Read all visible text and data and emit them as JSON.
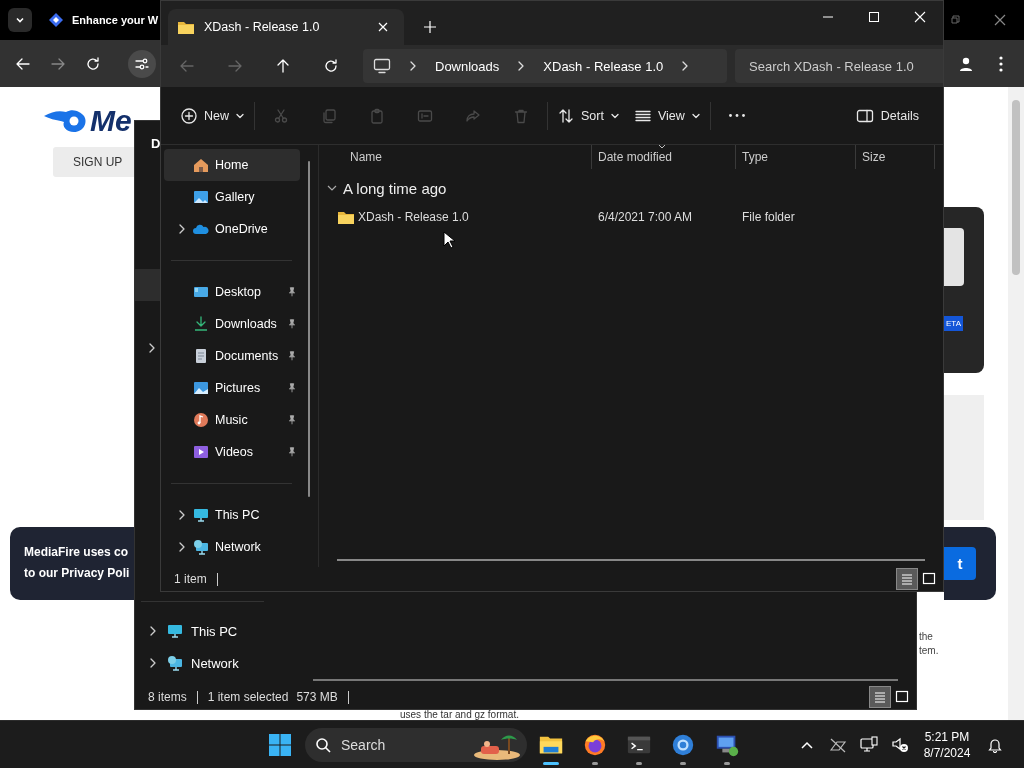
{
  "browser": {
    "tab": {
      "title": "Enhance your W"
    },
    "page": {
      "logo_text": "Me",
      "signup_button": "SIGN UP",
      "cookie_text": [
        "MediaFire uses co",
        "to our Privacy Poli"
      ],
      "badge": "ETA",
      "accept_button": "t",
      "side_text": [
        "the",
        "tem."
      ],
      "footer_text": "uses the tar and gz format."
    }
  },
  "back_explorer": {
    "heading": "D",
    "sidebar": [
      {
        "label": "This PC",
        "kind": "pc",
        "expandable": true
      },
      {
        "label": "Network",
        "kind": "network",
        "expandable": true
      }
    ],
    "status": {
      "count": "8 items",
      "selection": "1 item selected",
      "size": "573 MB"
    },
    "views": [
      {
        "kind": "details",
        "selected": true
      },
      {
        "kind": "tiles",
        "selected": false
      }
    ]
  },
  "explorer": {
    "tab": {
      "title": "XDash - Release 1.0"
    },
    "nav_buttons": [
      {
        "kind": "back",
        "disabled": true
      },
      {
        "kind": "forward",
        "disabled": true
      },
      {
        "kind": "up",
        "disabled": false
      },
      {
        "kind": "refresh",
        "disabled": false
      }
    ],
    "breadcrumb": [
      "Downloads",
      "XDash - Release 1.0"
    ],
    "search": {
      "placeholder": "Search XDash - Release 1.0"
    },
    "commands": [
      {
        "kind": "new",
        "label": "New",
        "dropdown": true,
        "disabled": false
      },
      {
        "kind": "cut",
        "disabled": true
      },
      {
        "kind": "copy",
        "disabled": true
      },
      {
        "kind": "paste",
        "disabled": true
      },
      {
        "kind": "rename",
        "disabled": true
      },
      {
        "kind": "share",
        "disabled": true
      },
      {
        "kind": "delete",
        "disabled": true
      },
      {
        "kind": "sort",
        "label": "Sort",
        "dropdown": true,
        "disabled": false
      },
      {
        "kind": "view",
        "label": "View",
        "dropdown": true,
        "disabled": false
      },
      {
        "kind": "more",
        "disabled": false
      }
    ],
    "details_button": "Details",
    "sidebar": [
      {
        "items": [
          {
            "label": "Home",
            "kind": "home",
            "selected": true,
            "expandable": false,
            "pinned": false
          },
          {
            "label": "Gallery",
            "kind": "gallery",
            "selected": false,
            "expandable": false,
            "pinned": false
          },
          {
            "label": "OneDrive",
            "kind": "cloud",
            "selected": false,
            "expandable": true,
            "pinned": false
          }
        ]
      },
      {
        "items": [
          {
            "label": "Desktop",
            "kind": "desktop",
            "selected": false,
            "expandable": false,
            "pinned": true
          },
          {
            "label": "Downloads",
            "kind": "downloads",
            "selected": false,
            "expandable": false,
            "pinned": true
          },
          {
            "label": "Documents",
            "kind": "documents",
            "selected": false,
            "expandable": false,
            "pinned": true
          },
          {
            "label": "Pictures",
            "kind": "pictures",
            "selected": false,
            "expandable": false,
            "pinned": true
          },
          {
            "label": "Music",
            "kind": "music",
            "selected": false,
            "expandable": false,
            "pinned": true
          },
          {
            "label": "Videos",
            "kind": "videos",
            "selected": false,
            "expandable": false,
            "pinned": true
          }
        ]
      },
      {
        "items": [
          {
            "label": "This PC",
            "kind": "pc",
            "selected": false,
            "expandable": true,
            "pinned": false
          },
          {
            "label": "Network",
            "kind": "network",
            "selected": false,
            "expandable": true,
            "pinned": false
          }
        ]
      }
    ],
    "columns": [
      {
        "label": "Name",
        "sorted": false
      },
      {
        "label": "Date modified",
        "sorted": true
      },
      {
        "label": "Type",
        "sorted": false
      },
      {
        "label": "Size",
        "sorted": false
      }
    ],
    "groups": [
      {
        "title": "A long time ago",
        "expanded": true,
        "rows": [
          {
            "name": "XDash - Release 1.0",
            "date_modified": "6/4/2021 7:00 AM",
            "type": "File folder",
            "selected": false
          }
        ]
      }
    ],
    "status": {
      "count": "1 item"
    },
    "views": [
      {
        "kind": "details",
        "selected": true
      },
      {
        "kind": "tiles",
        "selected": false
      }
    ]
  },
  "taskbar": {
    "search": {
      "placeholder": "Search"
    },
    "apps": [
      {
        "kind": "explorer",
        "active": true
      },
      {
        "kind": "firefox",
        "active": false
      },
      {
        "kind": "terminal",
        "active": false
      },
      {
        "kind": "browser",
        "active": false
      },
      {
        "kind": "remote",
        "active": false
      }
    ],
    "clock": {
      "time": "5:21 PM",
      "date": "8/7/2024"
    }
  }
}
